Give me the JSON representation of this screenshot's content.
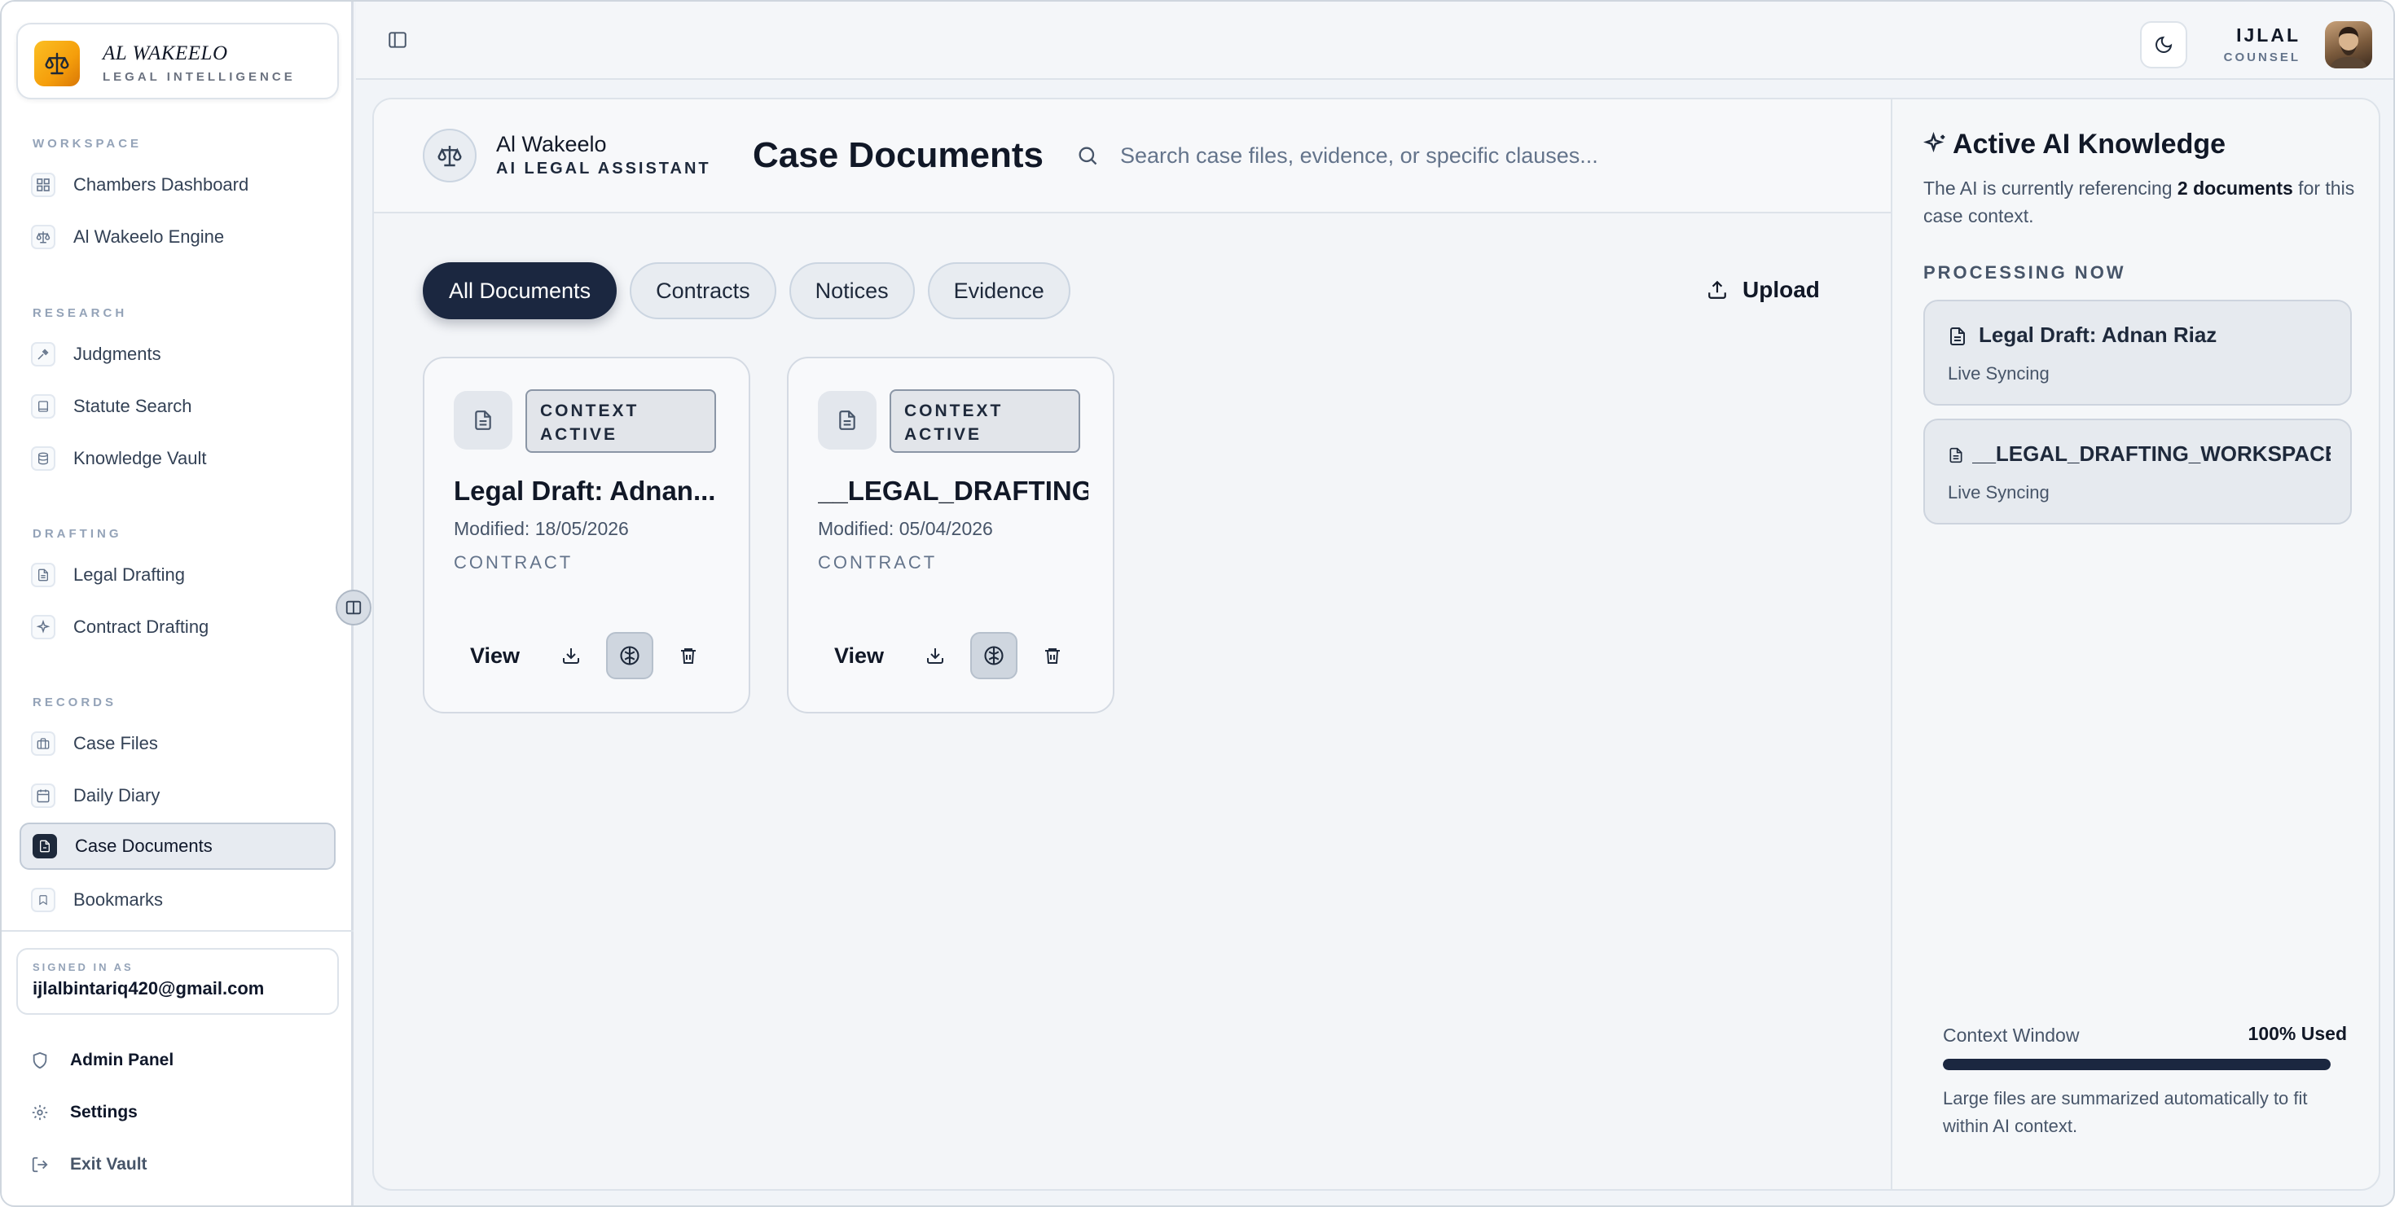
{
  "brand": {
    "title": "AL WAKEELO",
    "subtitle": "LEGAL INTELLIGENCE"
  },
  "sidebar": {
    "sections": [
      {
        "label": "WORKSPACE",
        "items": [
          {
            "label": "Chambers Dashboard",
            "icon": "grid-icon"
          },
          {
            "label": "Al Wakeelo Engine",
            "icon": "scales-icon"
          }
        ]
      },
      {
        "label": "RESEARCH",
        "items": [
          {
            "label": "Judgments",
            "icon": "gavel-icon"
          },
          {
            "label": "Statute Search",
            "icon": "book-icon"
          },
          {
            "label": "Knowledge Vault",
            "icon": "database-icon"
          }
        ]
      },
      {
        "label": "DRAFTING",
        "items": [
          {
            "label": "Legal Drafting",
            "icon": "file-text-icon"
          },
          {
            "label": "Contract Drafting",
            "icon": "sparkle-icon"
          }
        ]
      },
      {
        "label": "RECORDS",
        "items": [
          {
            "label": "Case Files",
            "icon": "briefcase-icon"
          },
          {
            "label": "Daily Diary",
            "icon": "calendar-icon"
          },
          {
            "label": "Case Documents",
            "icon": "documents-icon",
            "active": true
          },
          {
            "label": "Bookmarks",
            "icon": "bookmark-icon"
          }
        ]
      }
    ],
    "signed_in_label": "SIGNED IN AS",
    "signed_in_email": "ijlalbintariq420@gmail.com",
    "footer": {
      "admin": "Admin Panel",
      "settings": "Settings",
      "exit": "Exit Vault"
    }
  },
  "topbar": {
    "user_name": "IJLAL",
    "user_role": "COUNSEL"
  },
  "header": {
    "assistant_name": "Al Wakeelo",
    "assistant_subtitle": "AI LEGAL ASSISTANT",
    "page_title": "Case Documents",
    "search_placeholder": "Search case files, evidence, or specific clauses..."
  },
  "tabs": [
    {
      "label": "All Documents",
      "active": true
    },
    {
      "label": "Contracts"
    },
    {
      "label": "Notices"
    },
    {
      "label": "Evidence"
    }
  ],
  "upload_label": "Upload",
  "documents": [
    {
      "badge_line1": "CONTEXT",
      "badge_line2": "ACTIVE",
      "title": "Legal Draft: Adnan...",
      "modified": "Modified: 18/05/2026",
      "type": "CONTRACT",
      "view_label": "View"
    },
    {
      "badge_line1": "CONTEXT",
      "badge_line2": "ACTIVE",
      "title": "__LEGAL_DRAFTING",
      "modified": "Modified: 05/04/2026",
      "type": "CONTRACT",
      "view_label": "View"
    }
  ],
  "knowledge": {
    "title": "Active AI Knowledge",
    "desc_prefix": "The AI is currently referencing ",
    "desc_count": "2 documents",
    "desc_suffix": " for this case context.",
    "processing_label": "PROCESSING NOW",
    "items": [
      {
        "name": "Legal Draft: Adnan Riaz",
        "status": "Live Syncing"
      },
      {
        "name": "__LEGAL_DRAFTING_WORKSPACE",
        "status": "Live Syncing"
      }
    ],
    "context_label": "Context Window",
    "context_value": "100% Used",
    "context_fraction": 1.0,
    "context_note": "Large files are summarized automatically to fit within AI context."
  }
}
